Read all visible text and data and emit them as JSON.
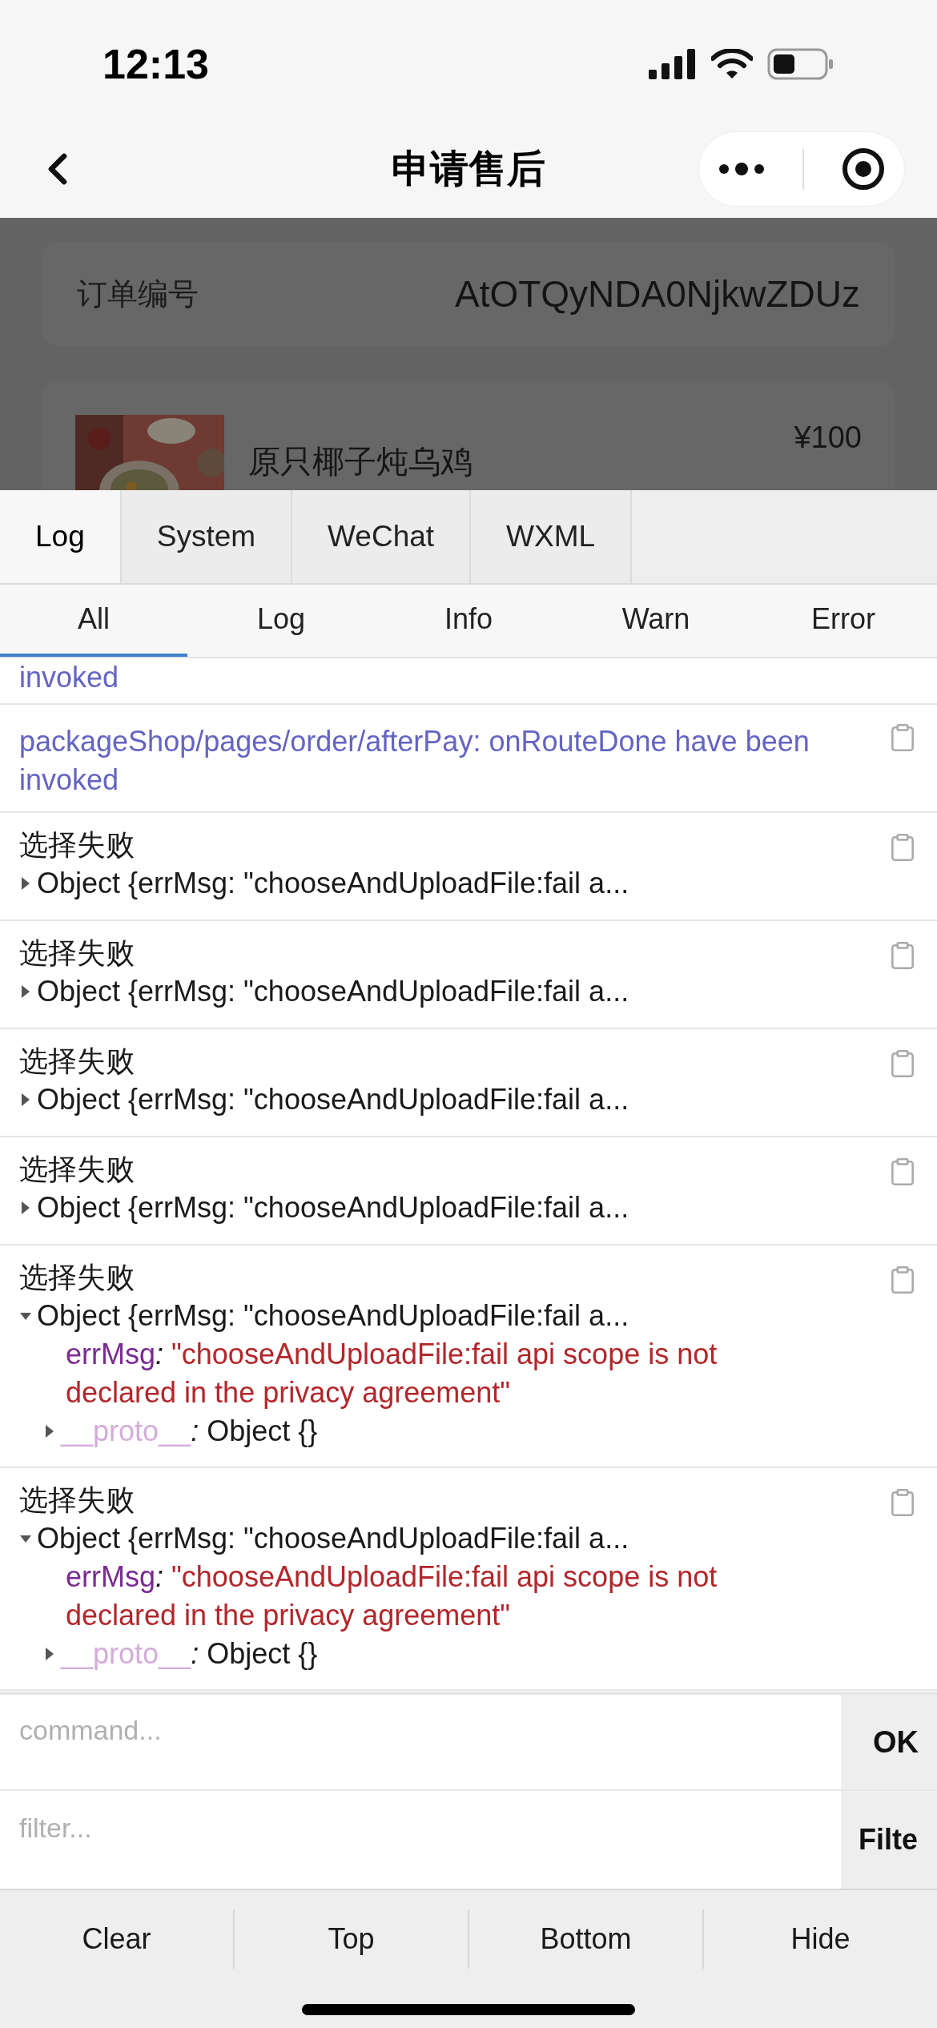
{
  "status_bar": {
    "time": "12:13"
  },
  "nav": {
    "title": "申请售后"
  },
  "page": {
    "order": {
      "label": "订单编号",
      "value": "AtOTQyNDA0NjkwZDUz"
    },
    "product": {
      "name": "原只椰子炖乌鸡",
      "price": "¥100"
    }
  },
  "panel_tabs": [
    {
      "label": "Log",
      "selected": true
    },
    {
      "label": "System",
      "selected": false
    },
    {
      "label": "WeChat",
      "selected": false
    },
    {
      "label": "WXML",
      "selected": false
    }
  ],
  "level_tabs": [
    {
      "label": "All",
      "selected": true
    },
    {
      "label": "Log",
      "selected": false
    },
    {
      "label": "Info",
      "selected": false
    },
    {
      "label": "Warn",
      "selected": false
    },
    {
      "label": "Error",
      "selected": false
    }
  ],
  "logs": [
    {
      "kind": "info",
      "text": "invoked",
      "copy": false
    },
    {
      "kind": "info",
      "text": "packageShop/pages/order/afterPay: onRouteDone have been invoked",
      "copy": true
    },
    {
      "kind": "group",
      "label": "选择失败",
      "summary": "Object {errMsg: \"chooseAndUploadFile:fail a...",
      "expanded": false,
      "copy": true
    },
    {
      "kind": "group",
      "label": "选择失败",
      "summary": "Object {errMsg: \"chooseAndUploadFile:fail a...",
      "expanded": false,
      "copy": true
    },
    {
      "kind": "group",
      "label": "选择失败",
      "summary": "Object {errMsg: \"chooseAndUploadFile:fail a...",
      "expanded": false,
      "copy": true
    },
    {
      "kind": "group",
      "label": "选择失败",
      "summary": "Object {errMsg: \"chooseAndUploadFile:fail a...",
      "expanded": false,
      "copy": true
    },
    {
      "kind": "group",
      "label": "选择失败",
      "summary": "Object {errMsg: \"chooseAndUploadFile:fail a...",
      "expanded": true,
      "copy": true,
      "properties": [
        {
          "key": "errMsg",
          "sep": ":",
          "value": "\"chooseAndUploadFile:fail api scope is not declared in the privacy agreement\""
        }
      ],
      "proto": {
        "key": "__proto__",
        "sep": ":",
        "value": "Object {}",
        "expanded": false
      }
    },
    {
      "kind": "group",
      "label": "选择失败",
      "summary": "Object {errMsg: \"chooseAndUploadFile:fail a...",
      "expanded": true,
      "copy": true,
      "properties": [
        {
          "key": "errMsg",
          "sep": ":",
          "value": "\"chooseAndUploadFile:fail api scope is not declared in the privacy agreement\""
        }
      ],
      "proto": {
        "key": "__proto__",
        "sep": ":",
        "value": "Object {}",
        "expanded": false
      }
    }
  ],
  "command": {
    "placeholder": "command...",
    "button": "OK"
  },
  "filter": {
    "placeholder": "filter...",
    "button": "Filte"
  },
  "toolbar": [
    "Clear",
    "Top",
    "Bottom",
    "Hide"
  ]
}
